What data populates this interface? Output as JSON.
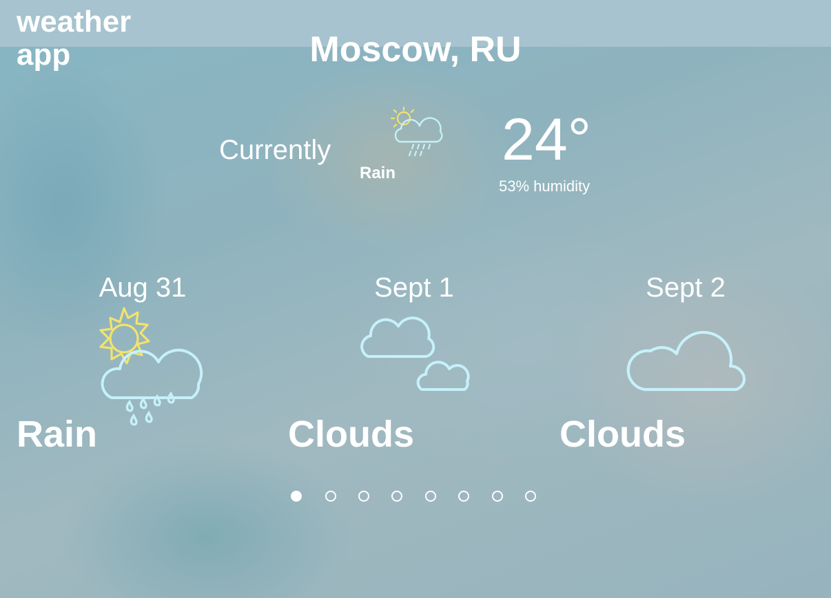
{
  "app": {
    "title": "weather app"
  },
  "location": {
    "city": "Moscow, RU"
  },
  "current": {
    "label": "Currently",
    "condition": "Rain",
    "temperature": "24°",
    "humidity": "53% humidity",
    "icon": "sun-cloud-rain-icon"
  },
  "forecast": [
    {
      "date": "Aug 31",
      "condition": "Rain",
      "icon": "sun-cloud-rain-icon"
    },
    {
      "date": "Sept 1",
      "condition": "Clouds",
      "icon": "two-clouds-icon"
    },
    {
      "date": "Sept 2",
      "condition": "Clouds",
      "icon": "cloud-icon"
    }
  ],
  "pagination": {
    "total": 8,
    "active_index": 0
  },
  "colors": {
    "sun": "#f3e36b",
    "cloud": "#c6f1fa",
    "rain": "#c6f1fa",
    "topbar": "#a6c3cf",
    "text": "#ffffff"
  }
}
